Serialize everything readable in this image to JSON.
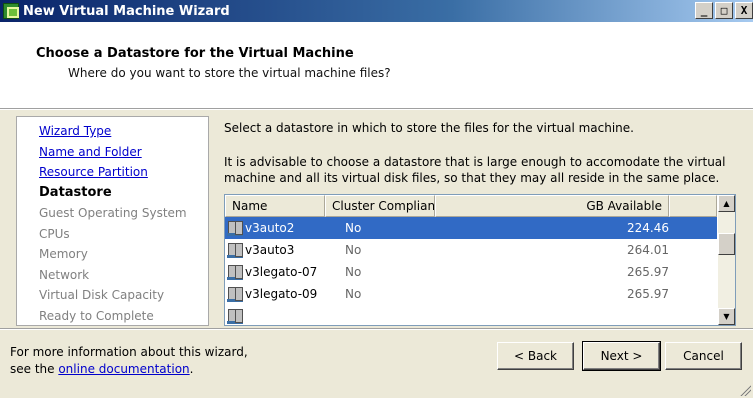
{
  "window": {
    "title": "New Virtual Machine Wizard",
    "controls": [
      "_",
      "□",
      "X"
    ]
  },
  "header": {
    "title": "Choose a Datastore for the Virtual Machine",
    "subtitle": "Where do you want to store the virtual machine files?"
  },
  "nav": {
    "items": [
      {
        "label": "Wizard Type",
        "state": "completed"
      },
      {
        "label": "Name and Folder",
        "state": "completed"
      },
      {
        "label": "Resource Partition",
        "state": "completed"
      },
      {
        "label": "Datastore",
        "state": "current"
      },
      {
        "label": "Guest Operating System",
        "state": "pending"
      },
      {
        "label": "CPUs",
        "state": "pending"
      },
      {
        "label": "Memory",
        "state": "pending"
      },
      {
        "label": "Network",
        "state": "pending"
      },
      {
        "label": "Virtual Disk Capacity",
        "state": "pending"
      },
      {
        "label": "Ready to Complete",
        "state": "pending"
      }
    ]
  },
  "content": {
    "instruction": "Select a datastore in which to store the files for the virtual machine.",
    "advice": "It is advisable to choose a datastore that is large enough to accomodate the virtual machine and all its virtual disk files, so that they may all reside in the same place."
  },
  "table": {
    "columns": [
      "Name",
      "Cluster Compliant",
      "GB Available"
    ],
    "rows": [
      {
        "name": "v3auto2",
        "cluster": "No",
        "gb": "224.46",
        "selected": true
      },
      {
        "name": "v3auto3",
        "cluster": "No",
        "gb": "264.01",
        "selected": false
      },
      {
        "name": "v3legato-07",
        "cluster": "No",
        "gb": "265.97",
        "selected": false
      },
      {
        "name": "v3legato-09",
        "cluster": "No",
        "gb": "265.97",
        "selected": false
      }
    ],
    "icon": "datastore-icon"
  },
  "footer": {
    "help_line1": "For more information about this wizard,",
    "help_prefix": "see the ",
    "help_link": "online documentation",
    "help_suffix": ".",
    "back_label": "< Back",
    "next_label": "Next >",
    "cancel_label": "Cancel"
  },
  "colors": {
    "title_bar": "#0a246a",
    "selection": "#316ac5",
    "link": "#0000cc",
    "dialog_bg": "#ece9d8"
  }
}
